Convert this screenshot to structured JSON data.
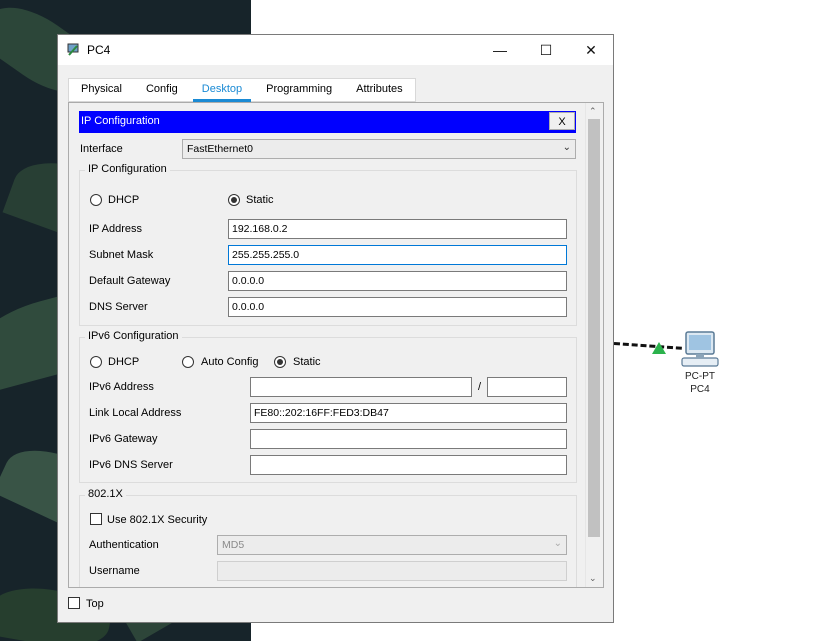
{
  "window": {
    "title": "PC4"
  },
  "tabs": [
    "Physical",
    "Config",
    "Desktop",
    "Programming",
    "Attributes"
  ],
  "active_tab": "Desktop",
  "panel": {
    "header": "IP Configuration",
    "close_label": "X",
    "interface_label": "Interface",
    "interface_value": "FastEthernet0",
    "ipv4": {
      "group_title": "IP Configuration",
      "dhcp_label": "DHCP",
      "static_label": "Static",
      "selected": "Static",
      "ip_label": "IP Address",
      "ip_value": "192.168.0.2",
      "mask_label": "Subnet Mask",
      "mask_value": "255.255.255.0",
      "gateway_label": "Default Gateway",
      "gateway_value": "0.0.0.0",
      "dns_label": "DNS Server",
      "dns_value": "0.0.0.0"
    },
    "ipv6": {
      "group_title": "IPv6 Configuration",
      "dhcp_label": "DHCP",
      "auto_label": "Auto Config",
      "static_label": "Static",
      "selected": "Static",
      "address_label": "IPv6 Address",
      "address_value": "",
      "prefix_separator": "/",
      "prefix_value": "",
      "link_local_label": "Link Local Address",
      "link_local_value": "FE80::202:16FF:FED3:DB47",
      "gateway_label": "IPv6 Gateway",
      "gateway_value": "",
      "dns_label": "IPv6 DNS Server",
      "dns_value": ""
    },
    "dot1x": {
      "group_title": "802.1X",
      "use_label": "Use 802.1X Security",
      "use_checked": false,
      "auth_label": "Authentication",
      "auth_value": "MD5",
      "username_label": "Username",
      "username_value": ""
    }
  },
  "top_checkbox": {
    "label": "Top",
    "checked": false
  },
  "topology": {
    "device_type": "PC-PT",
    "device_name": "PC4",
    "link_color": "#111111",
    "link_status_color": "#2bb24c"
  }
}
